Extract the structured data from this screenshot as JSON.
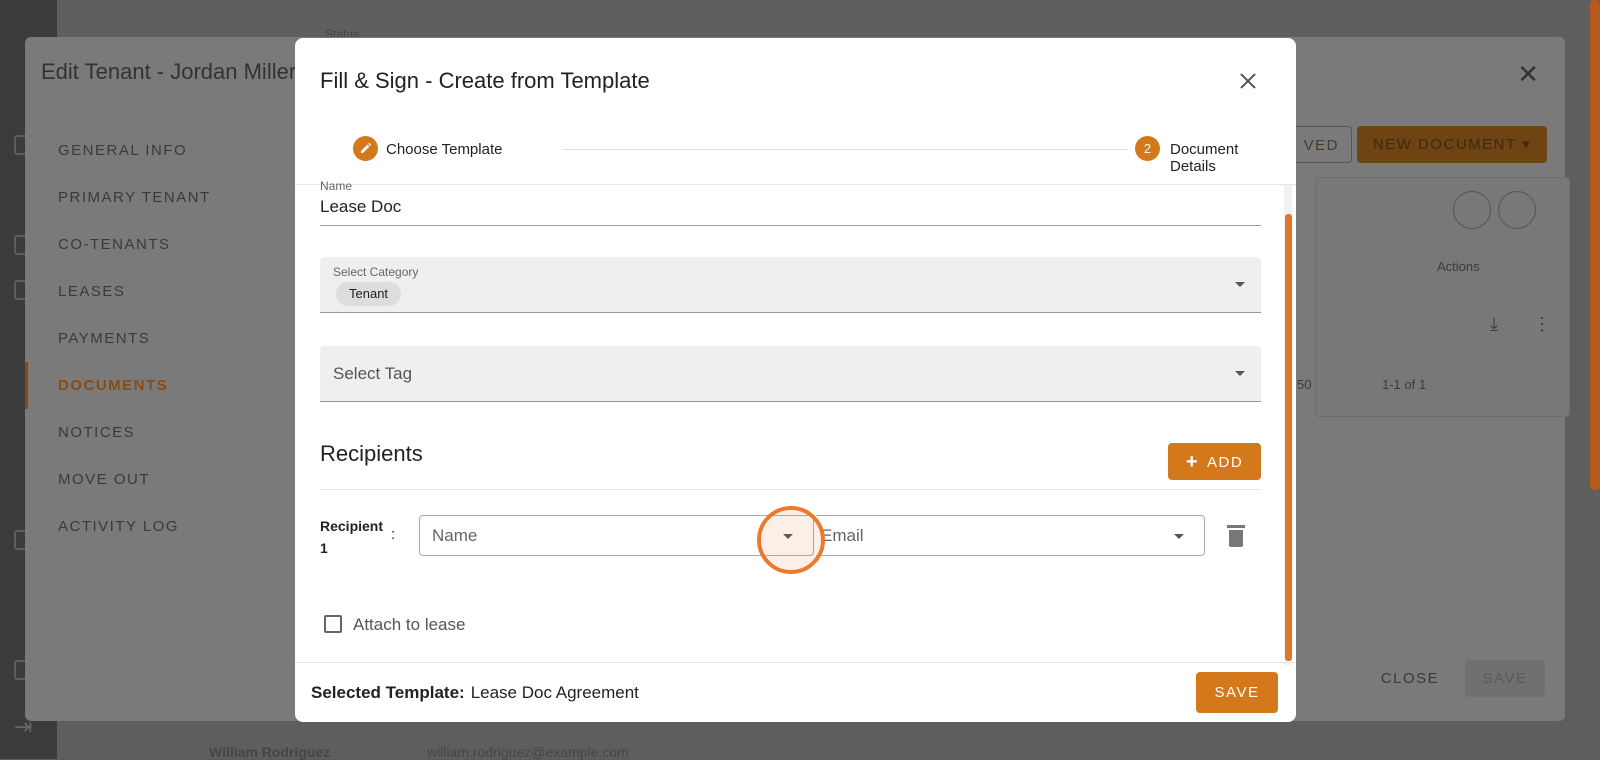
{
  "background": {
    "peek_status_label": "Status",
    "bottom_row_name": "William Rodriguez",
    "bottom_row_email": "william.rodriguez@example.com"
  },
  "tenant_panel": {
    "title": "Edit Tenant - Jordan Miller",
    "nav": [
      {
        "label": "GENERAL INFO"
      },
      {
        "label": "PRIMARY TENANT"
      },
      {
        "label": "CO-TENANTS"
      },
      {
        "label": "LEASES"
      },
      {
        "label": "PAYMENTS"
      },
      {
        "label": "DOCUMENTS",
        "active": true
      },
      {
        "label": "NOTICES"
      },
      {
        "label": "MOVE OUT"
      },
      {
        "label": "ACTIVITY LOG"
      }
    ],
    "archived_label": "VED",
    "new_document_label": "NEW DOCUMENT",
    "actions_header": "Actions",
    "per_page": "50",
    "pagination": "1-1 of 1",
    "close_label": "CLOSE",
    "save_label": "SAVE"
  },
  "modal": {
    "title": "Fill & Sign - Create from Template",
    "steps": [
      {
        "number": "",
        "icon": "pencil-icon",
        "label": "Choose Template"
      },
      {
        "number": "2",
        "label": "Document Details"
      }
    ],
    "name_field": {
      "label": "Name",
      "value": "Lease Doc"
    },
    "category_field": {
      "label": "Select Category",
      "chip": "Tenant"
    },
    "tag_field": {
      "placeholder": "Select Tag"
    },
    "recipients_title": "Recipients",
    "add_button": "ADD",
    "recipient": {
      "label": "Recipient 1",
      "colon": ":",
      "name_placeholder": "Name",
      "email_placeholder": "Email"
    },
    "attach_label": "Attach to lease",
    "selected_template_label": "Selected Template:",
    "selected_template_value": "Lease Doc Agreement",
    "save_button": "SAVE"
  },
  "colors": {
    "accent": "#d4781c",
    "click_ring": "#ea7a2e"
  }
}
